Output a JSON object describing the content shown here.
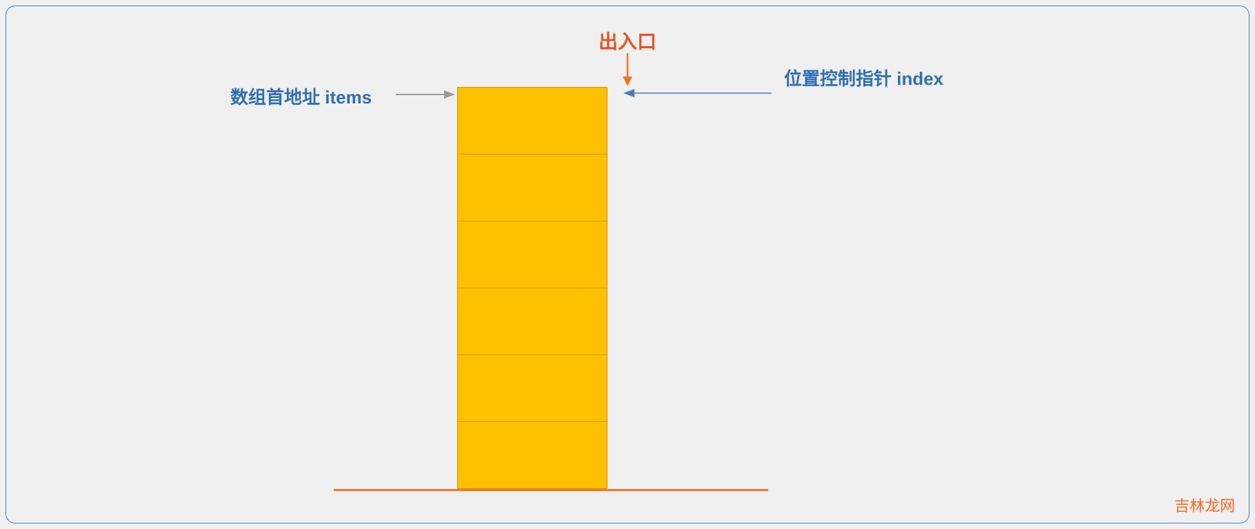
{
  "entry_label": "出入口",
  "left_label": "数组首地址 items",
  "right_label": "位置控制指针 index",
  "watermark": "吉林龙网",
  "stack": {
    "cell_count": 6
  },
  "colors": {
    "cell_fill": "#ffc000",
    "cell_border": "#d49400",
    "entry_text": "#e85322",
    "entry_arrow": "#f07824",
    "label_text": "#2f6fb5",
    "left_arrow": "#9a9a9a",
    "right_arrow": "#4a7fb5",
    "base_line": "#f07824",
    "frame_border": "#4a7fb5",
    "watermark": "#ff6620"
  }
}
